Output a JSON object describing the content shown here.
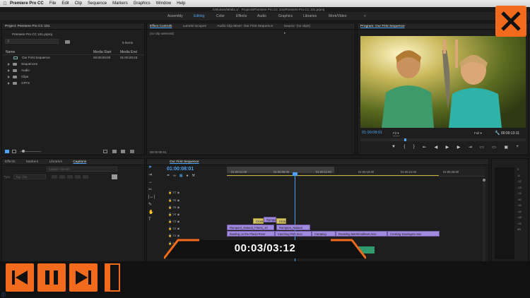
{
  "menubar": {
    "app": "Premiere Pro CC",
    "items": [
      "File",
      "Edit",
      "Clip",
      "Sequence",
      "Markers",
      "Graphics",
      "Window",
      "Help"
    ]
  },
  "title": "/Volumes/Media 1/ · Projects/Premiere Pro CC 101/Premiere Pro CC 101.prproj",
  "workspaces": [
    "Assembly",
    "Editing",
    "Color",
    "Effects",
    "Audio",
    "Graphics",
    "Libraries",
    "More/Video"
  ],
  "active_workspace": "Editing",
  "project": {
    "header": "Project: Premiere Pro CC 101",
    "file": "Premiere Pro CC 101.prproj",
    "item_count": "5 Items",
    "columns": [
      "Name",
      "Media Start",
      "Media End"
    ],
    "rows": [
      {
        "name": "Our First Sequence",
        "start": "00:00:00:00",
        "end": "01:00:29:23",
        "type": "sequence"
      },
      {
        "name": "Sequences",
        "type": "folder"
      },
      {
        "name": "Audio",
        "type": "folder"
      },
      {
        "name": "Clips",
        "type": "folder"
      },
      {
        "name": "GFFX",
        "type": "folder"
      }
    ],
    "timecode_bottom": "00:00:08:01"
  },
  "effects_panel": {
    "tabs": [
      "Effect Controls",
      "Lumetri Scopes",
      "Audio Clip Mixer: Our First Sequence",
      "Source: (no clips)"
    ],
    "empty": "(no clip selected)",
    "timecode": "00:00:08:01"
  },
  "program": {
    "header": "Program: Our First Sequence",
    "timecode": "01:00:08:01",
    "fit": "Fit",
    "quality": "Full",
    "duration": "00:00:13:11"
  },
  "left_bottom": {
    "tabs": [
      "Effects",
      "Markers",
      "Libraries",
      "Captions"
    ],
    "placeholder": "Caption Stream",
    "type_label": "Type:",
    "type_value": "Top: (No"
  },
  "timeline": {
    "tab": "Our First Sequence",
    "timecode": "01:00:08:01",
    "ruler": [
      "01:00:01:00",
      "01:00:06:00",
      "01:00:11:00",
      "01:00:16:00",
      "01:00:21:00",
      "01:00:26:00"
    ],
    "tracks": [
      "V7",
      "V6",
      "V5",
      "V4",
      "V3",
      "V2",
      "V1",
      "A1"
    ],
    "clips_v3": [
      {
        "label": "Cross",
        "color": "y"
      },
      {
        "label": "Rampa",
        "color": "v"
      },
      {
        "label": "Cross",
        "color": "y"
      }
    ],
    "clips_v2": [
      {
        "label": "Rampant_Natural_Flares_10",
        "color": "v"
      },
      {
        "label": "Rampant_Natural",
        "color": "v"
      }
    ],
    "clips_v1": [
      {
        "label": "Boating on the Placid River",
        "color": "v"
      },
      {
        "label": "Catching Fish.mov",
        "color": "v"
      },
      {
        "label": "Camping",
        "color": "v"
      },
      {
        "label": "Roasting Marshmallows.mov",
        "color": "v"
      },
      {
        "label": "Cooking Sausages.mov",
        "color": "v"
      }
    ]
  },
  "meters": [
    "0",
    "-6",
    "-12",
    "-18",
    "-24",
    "-30",
    "-36",
    "-42",
    "-48",
    "-54",
    "dB"
  ],
  "player": {
    "time": "00:03/03:12",
    "progress": 0.0155,
    "accent": "#f26b1d"
  },
  "colors": {
    "accent": "#f26b1d",
    "timecode": "#4fa3f7",
    "clip": "#a18be0"
  }
}
